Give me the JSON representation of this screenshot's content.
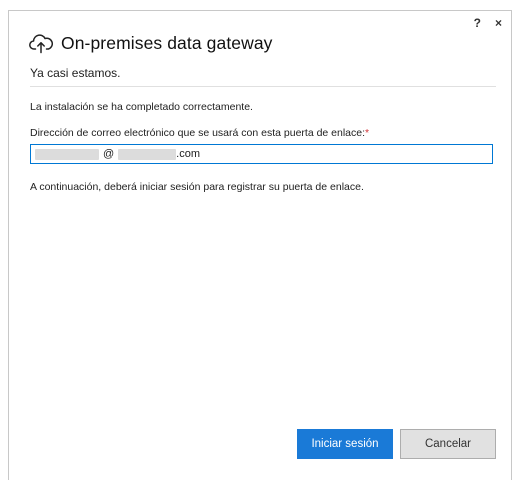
{
  "window": {
    "help_label": "?",
    "close_label": "×"
  },
  "header": {
    "icon": "cloud-upload-icon",
    "title": "On-premises data gateway",
    "subtitle": "Ya casi estamos."
  },
  "main": {
    "status_message": "La instalación se ha completado correctamente.",
    "email_label": "Dirección de correo electrónico que se usará con esta puerta de enlace:",
    "required_marker": "*",
    "email_value": {
      "at": "@",
      "tld": ".com"
    },
    "next_info": "A continuación, deberá iniciar sesión para registrar su puerta de enlace."
  },
  "footer": {
    "sign_in_label": "Iniciar sesión",
    "cancel_label": "Cancelar"
  },
  "colors": {
    "accent": "#1a7ad7",
    "required": "#d13438",
    "input_border": "#0078d4"
  }
}
